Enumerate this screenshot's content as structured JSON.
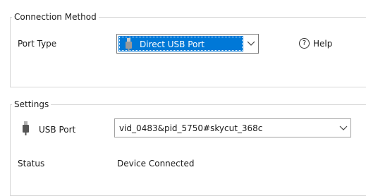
{
  "connection_method": {
    "legend": "Connection Method",
    "port_type_label": "Port Type",
    "port_type_value": "Direct USB Port",
    "port_type_icon": "usb-plug-icon",
    "help_label": "Help",
    "help_icon": "question-circle-icon"
  },
  "settings": {
    "legend": "Settings",
    "usb_port_label": "USB Port",
    "usb_port_icon": "usb-plug-icon",
    "usb_port_value": "vid_0483&pid_5750#skycut_368c",
    "status_label": "Status",
    "status_value": "Device Connected"
  },
  "colors": {
    "selection": "#0078d7",
    "group_border": "#d6d6d6"
  }
}
